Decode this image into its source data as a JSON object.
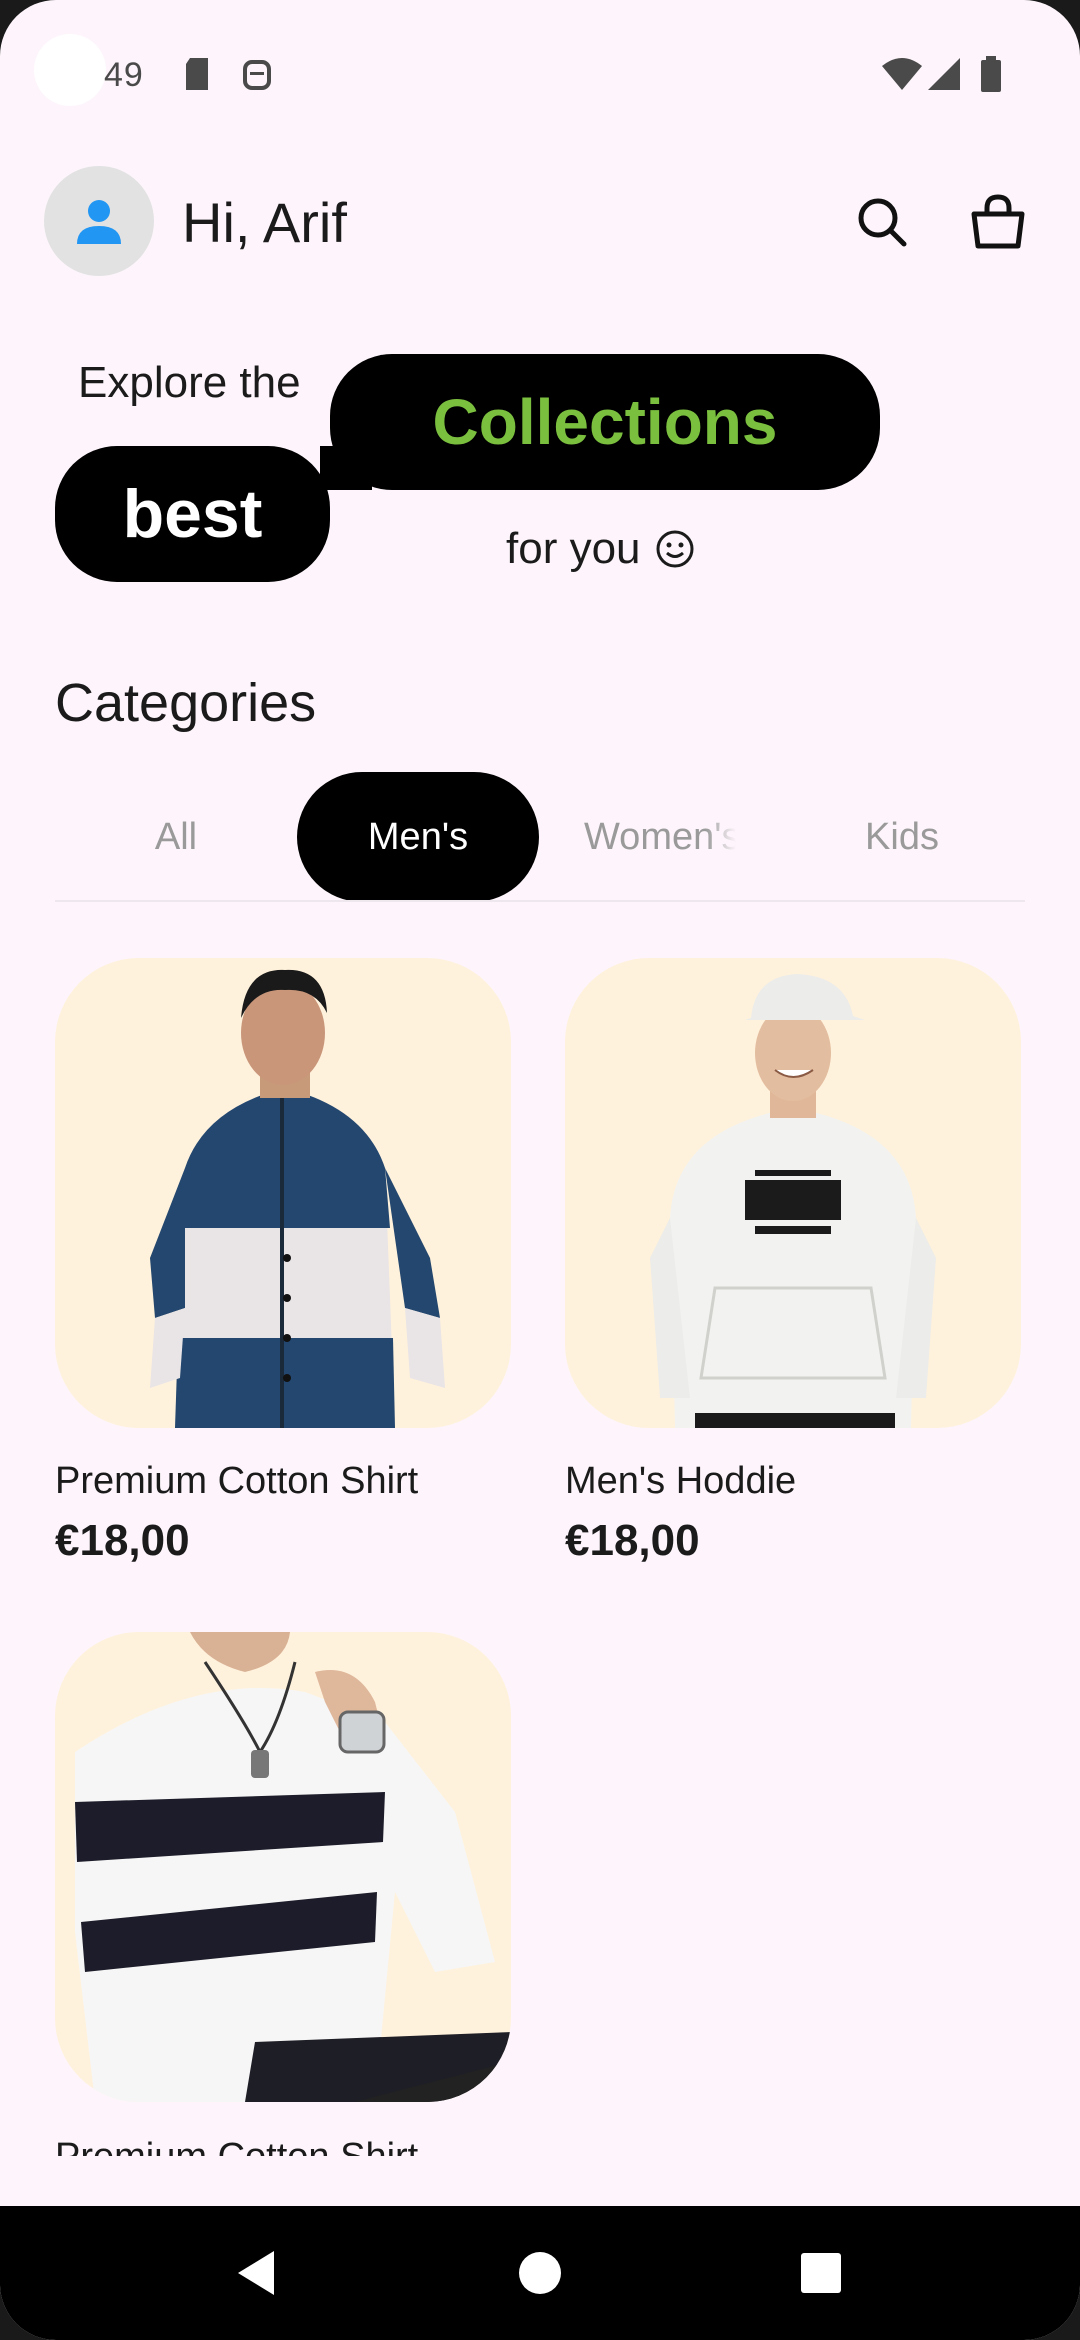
{
  "status_bar": {
    "time": "49"
  },
  "header": {
    "greeting": "Hi, Arif"
  },
  "hero": {
    "line1": "Explore the",
    "highlight1": "Collections",
    "highlight2": "best",
    "line2": "for you"
  },
  "categories": {
    "title": "Categories",
    "tabs": [
      {
        "label": "All",
        "active": false
      },
      {
        "label": "Men's",
        "active": true
      },
      {
        "label": "Women's",
        "active": false
      },
      {
        "label": "Kids",
        "active": false
      }
    ]
  },
  "products": [
    {
      "name": "Premium Cotton Shirt",
      "price": "€18,00",
      "image": "tie-dye-shirt-man"
    },
    {
      "name": "Men's Hoddie",
      "price": "€18,00",
      "image": "white-hoodie-man"
    },
    {
      "name": "Premium Cotton Shirt",
      "price": "",
      "image": "striped-tshirt"
    }
  ],
  "colors": {
    "accent": "#7bbf3f",
    "background": "#fdf5fb",
    "card_bg": "#fff2dc",
    "avatar_icon": "#2196f3"
  }
}
